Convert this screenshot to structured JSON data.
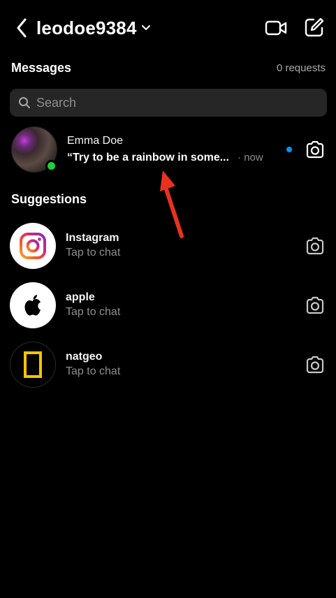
{
  "header": {
    "username": "leodoe9384"
  },
  "messages_section": {
    "title": "Messages",
    "requests": "0 requests"
  },
  "search": {
    "placeholder": "Search"
  },
  "conversation": {
    "name": "Emma Doe",
    "preview": "“Try to be a rainbow in some...",
    "time": "· now",
    "online": true,
    "unread": true
  },
  "suggestions_section": {
    "title": "Suggestions"
  },
  "suggestions": [
    {
      "name": "Instagram",
      "subtitle": "Tap to chat",
      "icon": "instagram-logo-icon"
    },
    {
      "name": "apple",
      "subtitle": "Tap to chat",
      "icon": "apple-logo-icon"
    },
    {
      "name": "natgeo",
      "subtitle": "Tap to chat",
      "icon": "natgeo-logo-icon"
    }
  ],
  "colors": {
    "background": "#000000",
    "search_bg": "#262626",
    "secondary_text": "#8e8e8e",
    "unread_dot": "#0095f6",
    "online_dot": "#1fcf3a",
    "annotation_arrow": "#e8321e",
    "natgeo_yellow": "#f5c400"
  }
}
